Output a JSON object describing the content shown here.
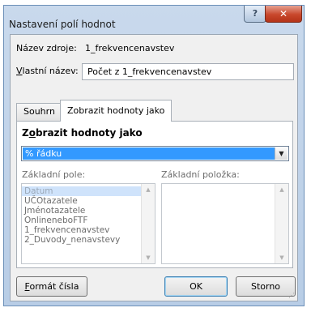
{
  "window": {
    "title": "Nastavení polí hodnot",
    "help_glyph": "?",
    "close_glyph": "✕"
  },
  "source": {
    "label": "Název zdroje:",
    "value": "1_frekvencenavstev"
  },
  "custom_name": {
    "label_accel": "V",
    "label_rest": "lastní název:",
    "value": "Počet z 1_frekvencenavstev"
  },
  "tabs": [
    {
      "label": "Souhrn",
      "active": false
    },
    {
      "label": "Zobrazit hodnoty jako",
      "active": true
    }
  ],
  "panel": {
    "section_accel": "o",
    "section_pre": "Z",
    "section_rest": "brazit hodnoty jako",
    "show_as_value": "% řádku",
    "base_field_label": "Základní pole:",
    "base_item_label": "Základní položka:",
    "base_fields": [
      "Datum",
      "UČOtazatele",
      "Jménotazatele",
      "OnlineneboFTF",
      "1_frekvencenavstev",
      "2_Duvody_nenavstevy"
    ],
    "selected_base_field": "Datum"
  },
  "buttons": {
    "number_format_accel": "F",
    "number_format_rest": "ormát čísla",
    "ok": "OK",
    "cancel": "Storno"
  },
  "icons": {
    "dropdown_arrow": "chevron-down-icon",
    "scroll_up": "scroll-up-icon",
    "scroll_down": "scroll-down-icon"
  }
}
